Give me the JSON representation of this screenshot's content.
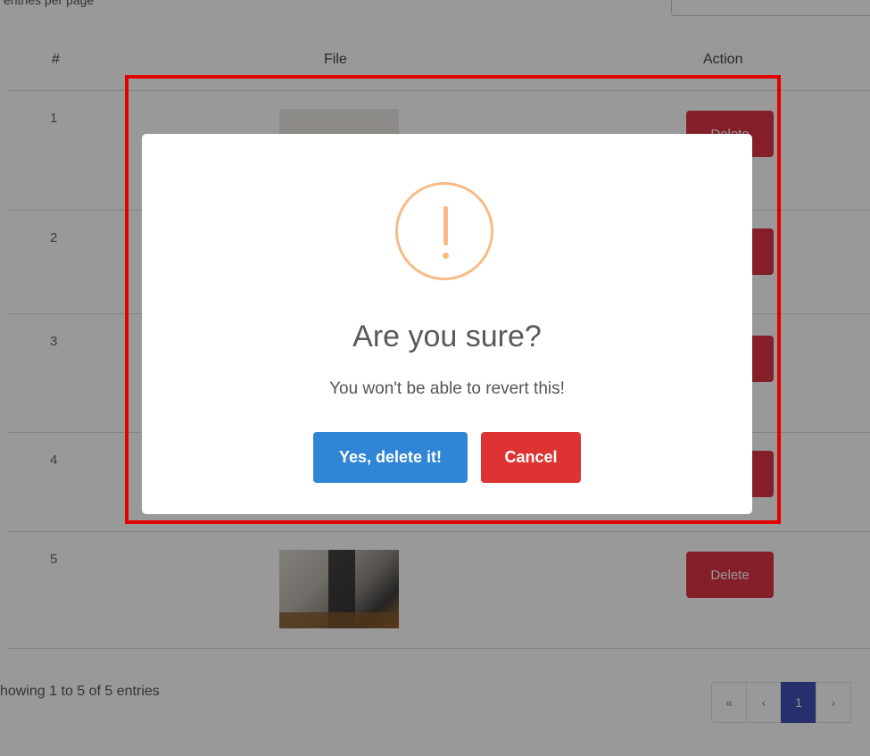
{
  "header": {
    "per_page_label": "entries per page"
  },
  "table": {
    "columns": [
      "#",
      "File",
      "Action"
    ],
    "rows": [
      {
        "num": "1",
        "action": "Delete"
      },
      {
        "num": "2",
        "action": "Delete"
      },
      {
        "num": "3",
        "action": "Delete"
      },
      {
        "num": "4",
        "action": "Delete"
      },
      {
        "num": "5",
        "action": "Delete"
      }
    ]
  },
  "footer": {
    "info": "howing 1 to 5 of 5 entries",
    "pagination": [
      "«",
      "‹",
      "1",
      "›"
    ]
  },
  "modal": {
    "icon": "warning-icon",
    "title": "Are you sure?",
    "text": "You won't be able to revert this!",
    "confirm_label": "Yes, delete it!",
    "cancel_label": "Cancel"
  },
  "colors": {
    "confirm": "#3085d6",
    "cancel": "#dd3333",
    "warning": "#f8bb86",
    "highlight": "#e10000",
    "page_active": "#3f51b5"
  }
}
